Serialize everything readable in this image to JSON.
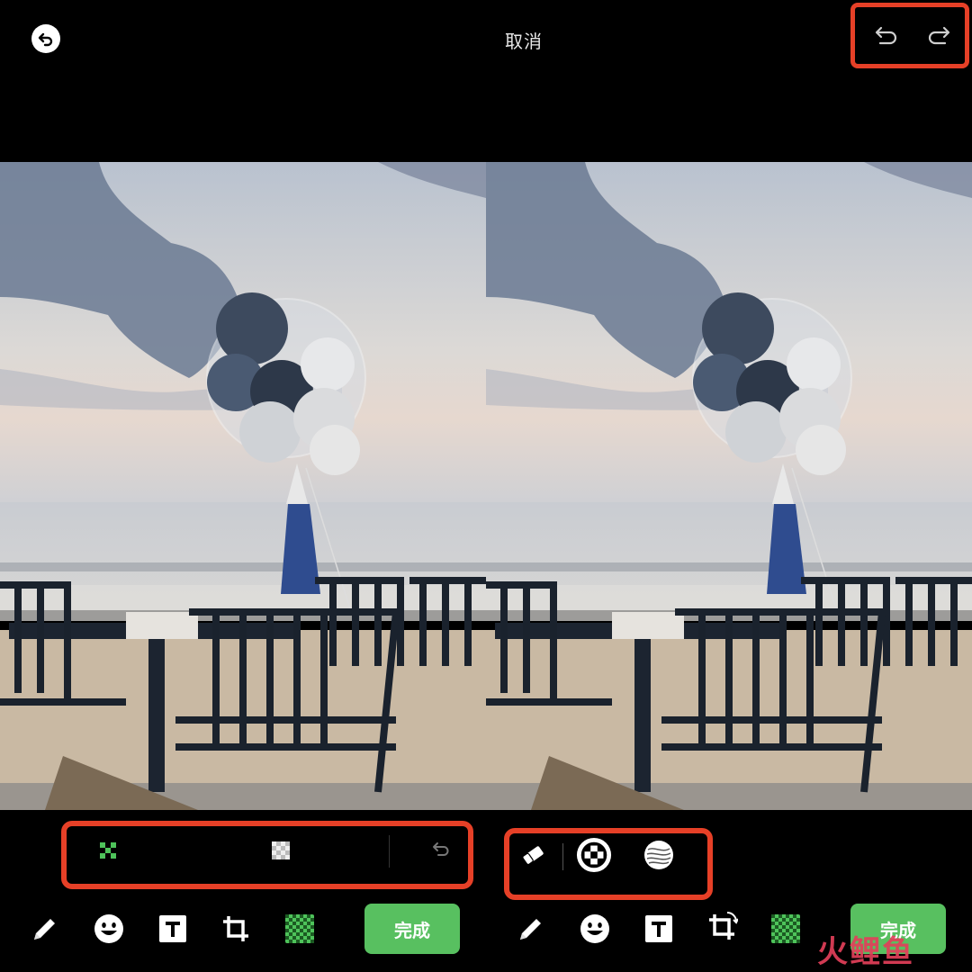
{
  "header": {
    "cancel_label": "取消",
    "back_icon": "back-arrow-icon",
    "undo_icon": "undo-icon",
    "redo_icon": "redo-icon"
  },
  "photo": {
    "description_icon": "balloon-beach-photo"
  },
  "mosaic_panel_left": {
    "tools": [
      "mosaic-dots-icon",
      "mosaic-pattern-icon",
      "undo-icon"
    ]
  },
  "mosaic_panel_right": {
    "tools": [
      "eraser-icon",
      "brush-size-icon",
      "texture-brush-icon"
    ]
  },
  "toolbar": {
    "tools": [
      "pencil-icon",
      "emoji-icon",
      "text-icon",
      "crop-icon",
      "mosaic-icon"
    ],
    "done_label": "完成"
  },
  "watermark": {
    "text": "火鲤鱼"
  },
  "colors": {
    "accent_green": "#58c060",
    "highlight_red": "#e64027",
    "mosaic_green": "#4ec35a"
  }
}
